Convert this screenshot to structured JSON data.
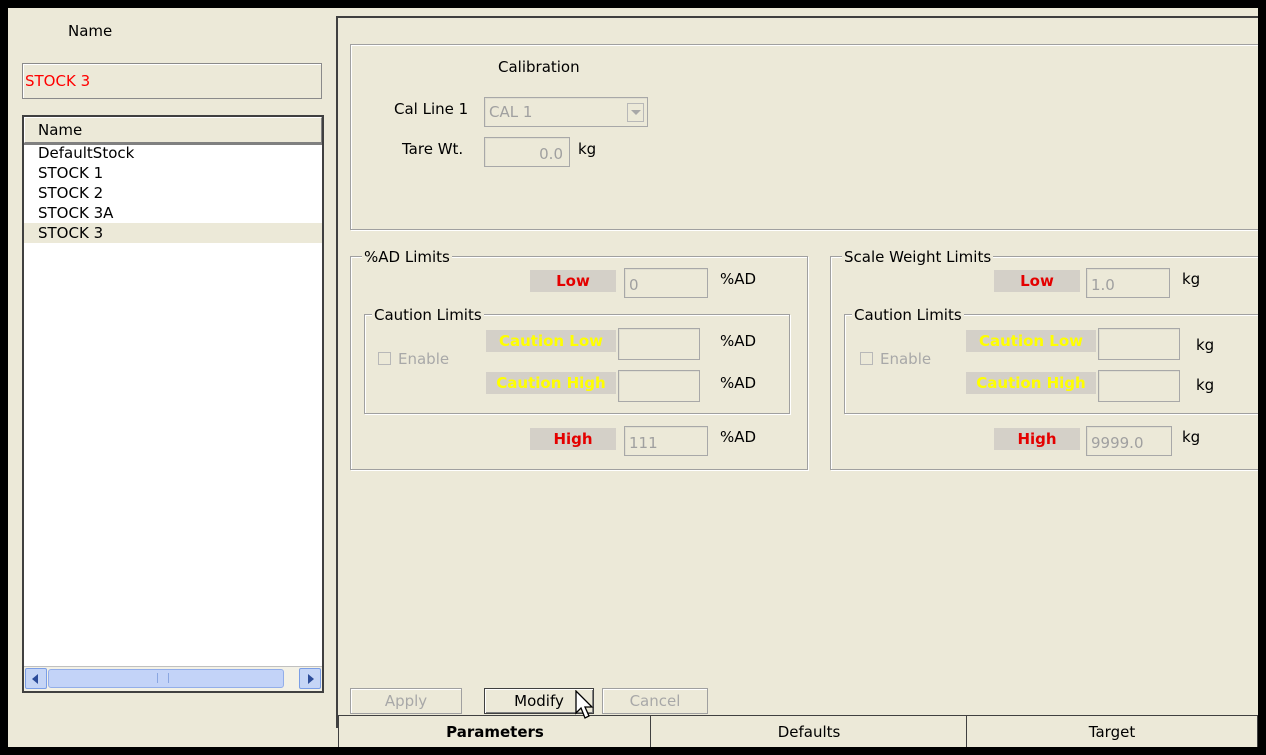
{
  "left": {
    "name_header": "Name",
    "current_name": "STOCK 3",
    "list_header": "Name",
    "items": [
      "DefaultStock",
      "STOCK 1",
      "STOCK 2",
      "STOCK 3A",
      "STOCK 3"
    ],
    "selected": "STOCK 3"
  },
  "calibration": {
    "title": "Calibration",
    "cal_line_label": "Cal Line 1",
    "cal_line_value": "CAL 1",
    "tare_label": "Tare Wt.",
    "tare_value": "0.0",
    "tare_unit": "kg"
  },
  "ad_limits": {
    "title": "%AD  Limits",
    "low_label": "Low",
    "low_value": "0",
    "unit": "%AD",
    "caution_title": "Caution Limits",
    "enable_label": "Enable",
    "caution_low_label": "Caution Low",
    "caution_high_label": "Caution High",
    "high_label": "High",
    "high_value": "111"
  },
  "scale_limits": {
    "title": "Scale Weight Limits",
    "low_label": "Low",
    "low_value": "1.0",
    "unit": "kg",
    "caution_title": "Caution Limits",
    "enable_label": "Enable",
    "caution_low_label": "Caution Low",
    "caution_high_label": "Caution High",
    "high_label": "High",
    "high_value": "9999.0"
  },
  "buttons": {
    "apply": "Apply",
    "modify": "Modify",
    "cancel": "Cancel"
  },
  "tabs": [
    {
      "label": "Parameters",
      "active": true
    },
    {
      "label": "Defaults",
      "active": false
    },
    {
      "label": "Target",
      "active": false
    }
  ],
  "colors": {
    "limit_label": "#e40000",
    "caution_label": "#ffff00",
    "current_name": "#ff0000"
  }
}
